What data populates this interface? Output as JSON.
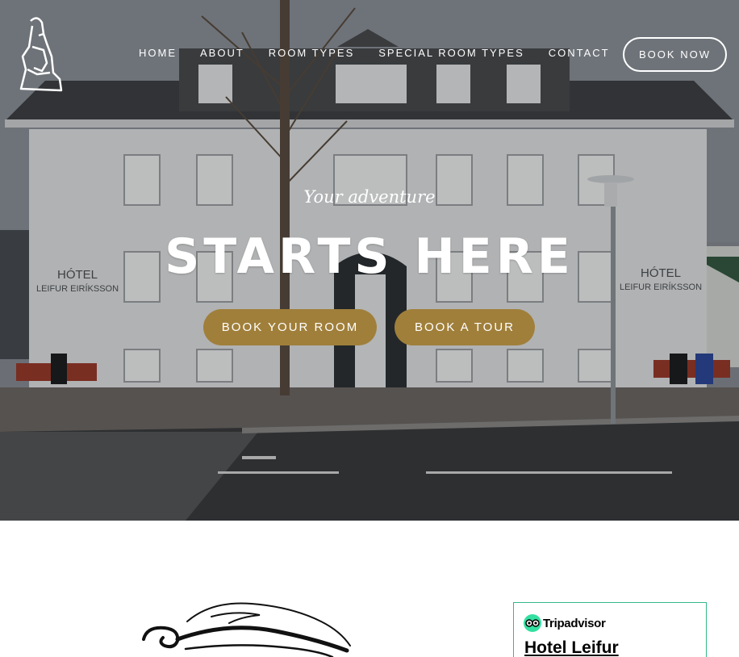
{
  "nav": {
    "items": [
      {
        "label": "HOME"
      },
      {
        "label": "ABOUT"
      },
      {
        "label": "ROOM TYPES"
      },
      {
        "label": "SPECIAL ROOM TYPES"
      },
      {
        "label": "CONTACT"
      }
    ],
    "book_now": "BOOK NOW"
  },
  "hero": {
    "tagline": "Your adventure",
    "headline": "STARTS HERE",
    "cta_book_room": "BOOK YOUR ROOM",
    "cta_book_tour": "BOOK A TOUR",
    "sign_left": [
      "HÓTEL",
      "LEIFUR EIRÍKSSON"
    ],
    "sign_right": [
      "HÓTEL",
      "LEIFUR EIRÍKSSON"
    ],
    "accent_color": "#a07f3a"
  },
  "tripadvisor": {
    "brand": "Tripadvisor",
    "hotel_name": "Hotel Leifur",
    "border_color": "#34b888",
    "logo_color": "#34e0a1"
  },
  "icons": {
    "logo": "statue-logo-icon",
    "ornament": "flourish-ornament-icon",
    "tripadvisor": "owl-eyes-icon"
  }
}
